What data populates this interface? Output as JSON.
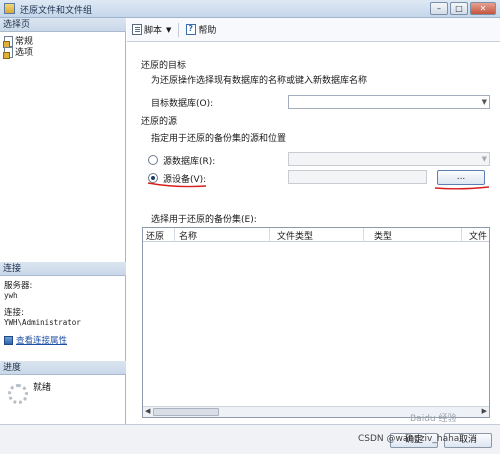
{
  "window": {
    "title": "还原文件和文件组",
    "minimize": "–",
    "maximize": "□",
    "close": "✕"
  },
  "left": {
    "pages_header": "选择页",
    "pages": [
      "常规",
      "选项"
    ],
    "connection_header": "连接",
    "server_label": "服务器:",
    "server_value": "ywh",
    "conn_label": "连接:",
    "conn_value": "YWH\\Administrator",
    "view_props_link": "查看连接属性",
    "progress_header": "进度",
    "progress_status": "就绪"
  },
  "toolbar": {
    "script_label": "脚本",
    "dropdown_arrow": "▼",
    "help_label": "帮助"
  },
  "form": {
    "restore_target_heading": "还原的目标",
    "restore_target_desc": "为还原操作选择现有数据库的名称或键入新数据库名称",
    "target_db_label": "目标数据库(O):",
    "target_db_value": "",
    "restore_source_heading": "还原的源",
    "restore_source_desc": "指定用于还原的备份集的源和位置",
    "source_db_label": "源数据库(R):",
    "source_db_value": "",
    "source_device_label": "源设备(V):",
    "source_device_value": "",
    "browse_label": "...",
    "selected_source": "device",
    "backup_sets_label": "选择用于还原的备份集(E):",
    "columns": [
      "还原",
      "名称",
      "文件类型",
      "类型",
      "文件"
    ]
  },
  "scroll": {
    "left": "◀",
    "right": "▶"
  },
  "footer": {
    "ok_label": "确定",
    "cancel_label": "取消",
    "watermark_csdn": "CSDN @wangziv_haha",
    "watermark_baidu": "Baidu 经验"
  },
  "colors": {
    "annotation_red": "#d81e1e",
    "link": "#1e4fa3"
  }
}
